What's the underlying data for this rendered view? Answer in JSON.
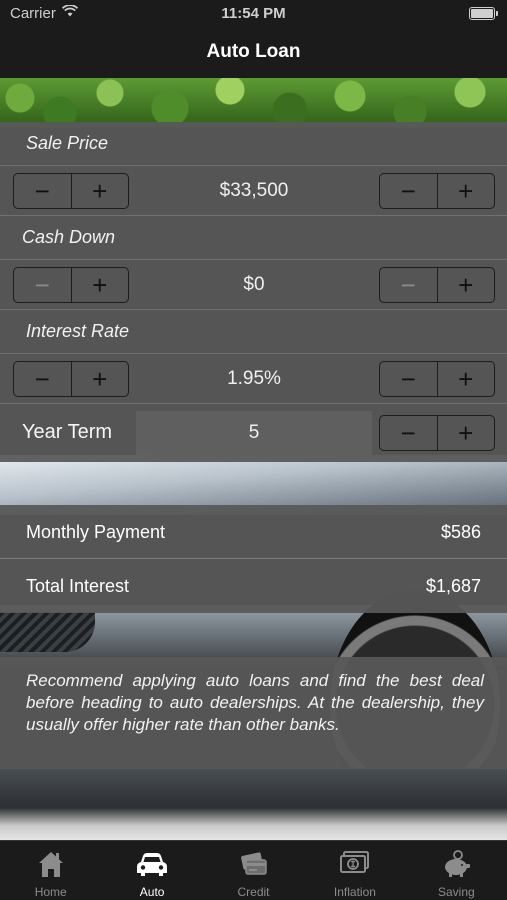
{
  "status_bar": {
    "carrier": "Carrier",
    "time": "11:54 PM"
  },
  "nav": {
    "title": "Auto Loan"
  },
  "inputs": {
    "sale_price": {
      "label": "Sale Price",
      "value": "$33,500"
    },
    "cash_down": {
      "label": "Cash Down",
      "value": "$0"
    },
    "interest_rate": {
      "label": "Interest Rate",
      "value": "1.95%"
    },
    "year_term": {
      "label": "Year Term",
      "value": "5"
    },
    "minus_glyph": "−",
    "plus_glyph": "+"
  },
  "results": {
    "monthly_payment": {
      "label": "Monthly Payment",
      "value": "$586"
    },
    "total_interest": {
      "label": "Total Interest",
      "value": "$1,687"
    }
  },
  "advice": {
    "text": "Recommend applying auto loans and find the best deal before heading to auto dealerships. At the dealership, they usually offer higher rate than other banks."
  },
  "tabbar": {
    "tabs": [
      {
        "label": "Home",
        "icon": "house-icon",
        "active": false
      },
      {
        "label": "Auto",
        "icon": "car-icon",
        "active": true
      },
      {
        "label": "Credit",
        "icon": "credit-card-icon",
        "active": false
      },
      {
        "label": "Inflation",
        "icon": "dollar-bills-icon",
        "active": false
      },
      {
        "label": "Saving",
        "icon": "piggy-bank-icon",
        "active": false
      }
    ]
  },
  "colors": {
    "panel": "#585858",
    "bar": "#1b1b1b",
    "active_tab": "#ffffff",
    "inactive_tab": "#8c8c8c"
  }
}
